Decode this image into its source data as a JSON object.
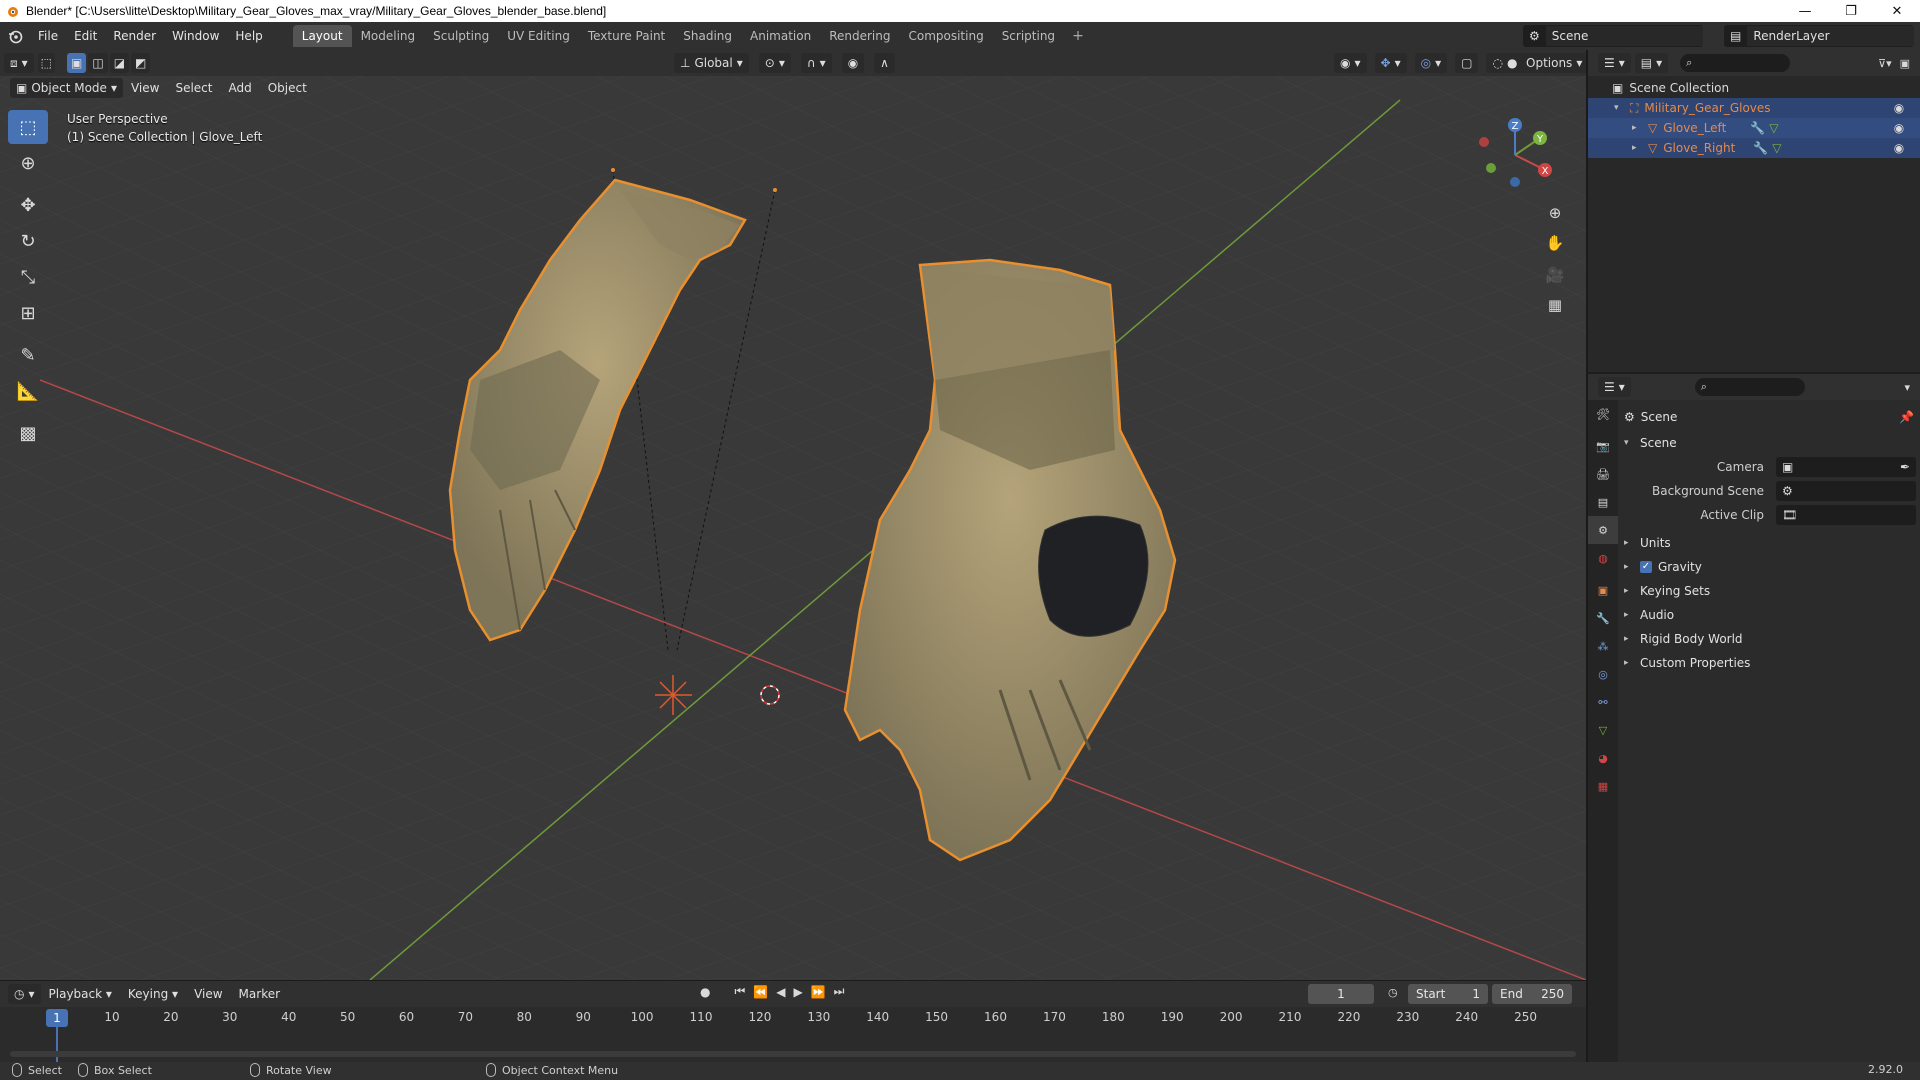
{
  "window": {
    "title": "Blender* [C:\\Users\\litte\\Desktop\\Military_Gear_Gloves_max_vray/Military_Gear_Gloves_blender_base.blend]",
    "controls": [
      "—",
      "❐",
      "✕"
    ]
  },
  "menubar": {
    "items": [
      "File",
      "Edit",
      "Render",
      "Window",
      "Help"
    ],
    "tabs": [
      "Layout",
      "Modeling",
      "Sculpting",
      "UV Editing",
      "Texture Paint",
      "Shading",
      "Animation",
      "Rendering",
      "Compositing",
      "Scripting"
    ],
    "active_tab": "Layout",
    "add_tab": "+",
    "scene": "Scene",
    "render_layer": "RenderLayer"
  },
  "viewport": {
    "mode": "Object Mode",
    "menus": [
      "View",
      "Select",
      "Add",
      "Object"
    ],
    "orientation": "Global",
    "options": "Options",
    "perspective_label": "User Perspective",
    "collection_label": "(1) Scene Collection | Glove_Left",
    "gizmo_axes": [
      "X",
      "Y",
      "Z"
    ]
  },
  "timeline": {
    "menus": [
      "Playback",
      "Keying",
      "View",
      "Marker"
    ],
    "current_frame": "1",
    "start_label": "Start",
    "start": "1",
    "end_label": "End",
    "end": "250",
    "ruler_ticks": [
      "1",
      "10",
      "20",
      "30",
      "40",
      "50",
      "60",
      "70",
      "80",
      "90",
      "100",
      "110",
      "120",
      "130",
      "140",
      "150",
      "160",
      "170",
      "180",
      "190",
      "200",
      "210",
      "220",
      "230",
      "240",
      "250"
    ]
  },
  "statusbar": {
    "select": "Select",
    "box_select": "Box Select",
    "rotate_view": "Rotate View",
    "context_menu": "Object Context Menu",
    "version": "2.92.0"
  },
  "outliner": {
    "root": "Scene Collection",
    "items": [
      {
        "label": "Military_Gear_Gloves",
        "color": "#e6894a"
      },
      {
        "label": "Glove_Left",
        "color": "#e6894a"
      },
      {
        "label": "Glove_Right",
        "color": "#e6894a"
      }
    ]
  },
  "properties": {
    "context": "Scene",
    "panel": "Scene",
    "fields": [
      {
        "label": "Camera",
        "value": ""
      },
      {
        "label": "Background Scene",
        "value": ""
      },
      {
        "label": "Active Clip",
        "value": ""
      }
    ],
    "subpanels": [
      "Units",
      "Gravity",
      "Keying Sets",
      "Audio",
      "Rigid Body World",
      "Custom Properties"
    ],
    "gravity_checked": true
  },
  "colors": {
    "accent": "#4772b3",
    "selection_outline": "#e8902f",
    "axis_x": "#c64a4a",
    "axis_y": "#6e9a3a"
  }
}
